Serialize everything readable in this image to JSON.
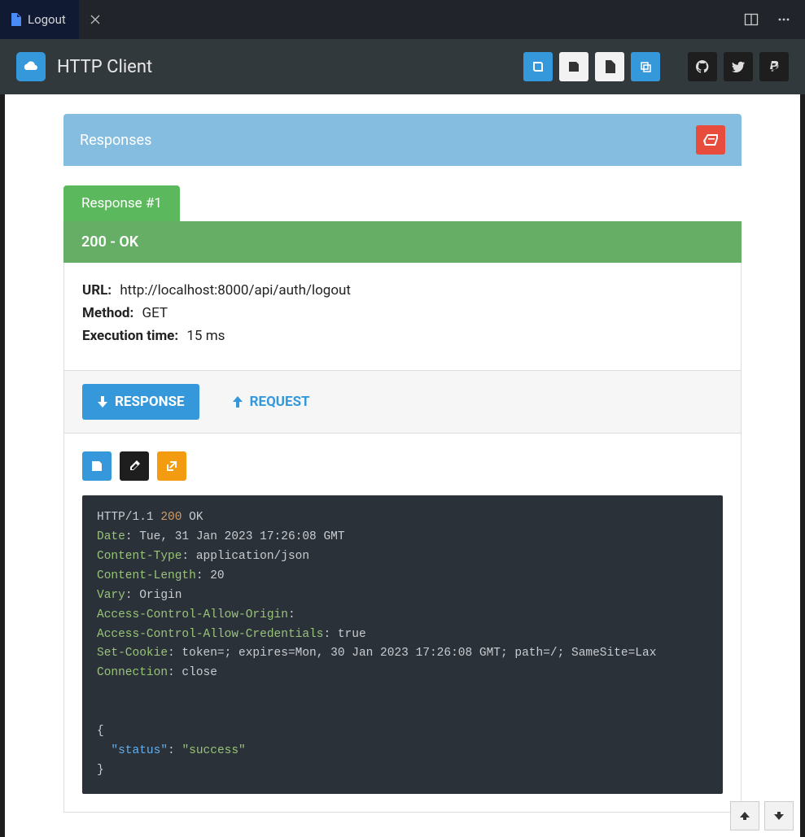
{
  "tab": {
    "label": "Logout"
  },
  "app": {
    "title": "HTTP Client"
  },
  "panel": {
    "title": "Responses"
  },
  "response": {
    "tab_label": "Response #1",
    "status_line": "200 - OK",
    "url_label": "URL:",
    "url": "http://localhost:8000/api/auth/logout",
    "method_label": "Method:",
    "method": "GET",
    "exec_label": "Execution time:",
    "exec_time": "15 ms"
  },
  "subtabs": {
    "response": "RESPONSE",
    "request": "REQUEST"
  },
  "raw": {
    "proto": "HTTP/1.1 ",
    "status_code": "200",
    "status_text": " OK",
    "headers": [
      {
        "k": "Date",
        "v": " Tue, 31 Jan 2023 17:26:08 GMT"
      },
      {
        "k": "Content-Type",
        "v": " application/json"
      },
      {
        "k": "Content-Length",
        "v": " 20"
      },
      {
        "k": "Vary",
        "v": " Origin"
      },
      {
        "k": "Access-Control-Allow-Origin",
        "v": ""
      },
      {
        "k": "Access-Control-Allow-Credentials",
        "v": " true"
      },
      {
        "k": "Set-Cookie",
        "v": " token=; expires=Mon, 30 Jan 2023 17:26:08 GMT; path=/; SameSite=Lax"
      },
      {
        "k": "Connection",
        "v": " close"
      }
    ],
    "body": {
      "open": "{",
      "indent": "  ",
      "key": "\"status\"",
      "colon": ": ",
      "value": "\"success\"",
      "close": "}"
    }
  }
}
